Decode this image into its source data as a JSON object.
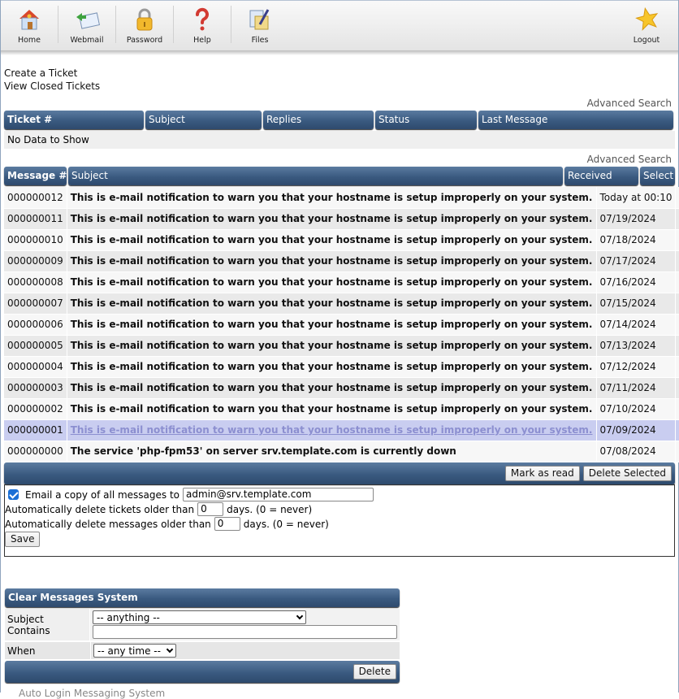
{
  "nav": {
    "items": [
      {
        "label": "Home",
        "icon": "home-icon"
      },
      {
        "label": "Webmail",
        "icon": "webmail-icon"
      },
      {
        "label": "Password",
        "icon": "lock-icon"
      },
      {
        "label": "Help",
        "icon": "help-icon"
      },
      {
        "label": "Files",
        "icon": "files-icon"
      }
    ],
    "logout": {
      "label": "Logout",
      "icon": "star-icon"
    }
  },
  "links": {
    "create_ticket": "Create a Ticket",
    "view_closed": "View Closed Tickets"
  },
  "tickets": {
    "advanced_search": "Advanced Search",
    "columns": [
      "Ticket #",
      "Subject",
      "Replies",
      "Status",
      "Last Message"
    ],
    "empty_text": "No Data to Show"
  },
  "messages": {
    "advanced_search": "Advanced Search",
    "columns": [
      "Message #",
      "Subject",
      "Received",
      "Select"
    ],
    "rows": [
      {
        "num": "000000012",
        "subject": "This is e-mail notification to warn you that your hostname is setup improperly on your system.",
        "received": "Today at 00:10",
        "checked": false
      },
      {
        "num": "000000011",
        "subject": "This is e-mail notification to warn you that your hostname is setup improperly on your system.",
        "received": "07/19/2024",
        "checked": false
      },
      {
        "num": "000000010",
        "subject": "This is e-mail notification to warn you that your hostname is setup improperly on your system.",
        "received": "07/18/2024",
        "checked": false
      },
      {
        "num": "000000009",
        "subject": "This is e-mail notification to warn you that your hostname is setup improperly on your system.",
        "received": "07/17/2024",
        "checked": false
      },
      {
        "num": "000000008",
        "subject": "This is e-mail notification to warn you that your hostname is setup improperly on your system.",
        "received": "07/16/2024",
        "checked": false
      },
      {
        "num": "000000007",
        "subject": "This is e-mail notification to warn you that your hostname is setup improperly on your system.",
        "received": "07/15/2024",
        "checked": false
      },
      {
        "num": "000000006",
        "subject": "This is e-mail notification to warn you that your hostname is setup improperly on your system.",
        "received": "07/14/2024",
        "checked": false
      },
      {
        "num": "000000005",
        "subject": "This is e-mail notification to warn you that your hostname is setup improperly on your system.",
        "received": "07/13/2024",
        "checked": false
      },
      {
        "num": "000000004",
        "subject": "This is e-mail notification to warn you that your hostname is setup improperly on your system.",
        "received": "07/12/2024",
        "checked": false
      },
      {
        "num": "000000003",
        "subject": "This is e-mail notification to warn you that your hostname is setup improperly on your system.",
        "received": "07/11/2024",
        "checked": false
      },
      {
        "num": "000000002",
        "subject": "This is e-mail notification to warn you that your hostname is setup improperly on your system.",
        "received": "07/10/2024",
        "checked": false
      },
      {
        "num": "000000001",
        "subject": "This is e-mail notification to warn you that your hostname is setup improperly on your system.",
        "received": "07/09/2024",
        "checked": false,
        "highlighted": true
      },
      {
        "num": "000000000",
        "subject": "The service 'php-fpm53' on server srv.template.com is currently down",
        "received": "07/08/2024",
        "checked": false
      }
    ],
    "mark_read_label": "Mark as read",
    "delete_selected_label": "Delete Selected"
  },
  "settings": {
    "email_copy_checked": true,
    "email_copy_label": "Email a copy of all messages to",
    "email_value": "admin@srv.template.com",
    "delete_tickets_label": "Automatically delete tickets older than",
    "delete_tickets_value": "0",
    "delete_messages_label": "Automatically delete messages older than",
    "delete_messages_value": "0",
    "days_suffix": "days. (0 = never)",
    "save_label": "Save"
  },
  "clear_messages": {
    "title": "Clear Messages System",
    "subject_label": "Subject Contains",
    "subject_select": "-- anything --",
    "subject_text": "",
    "when_label": "When",
    "when_select": "-- any time --",
    "delete_label": "Delete"
  },
  "cutoff_text": "Auto Login Messaging System"
}
